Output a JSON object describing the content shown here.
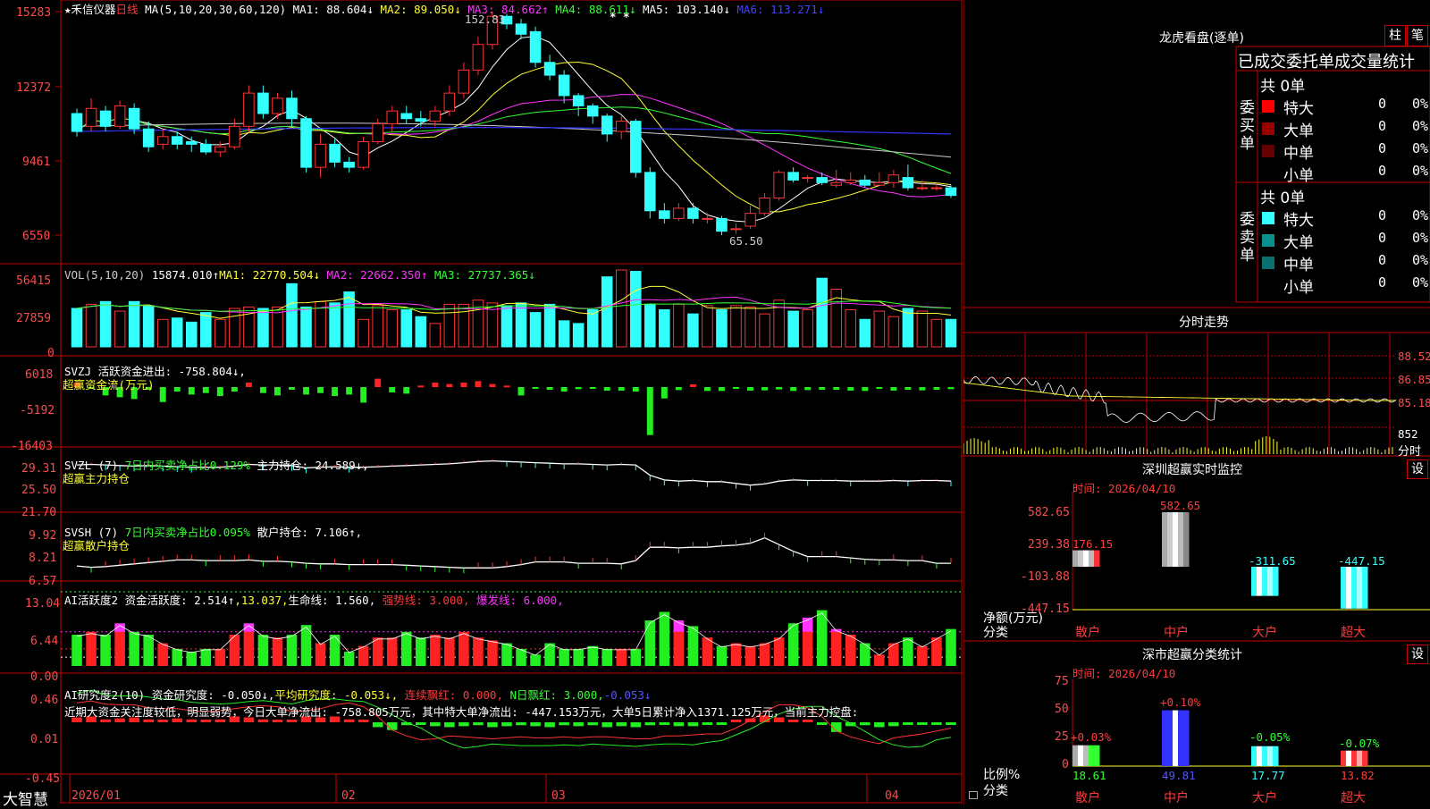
{
  "stock": {
    "name": "★禾信仪器",
    "period": "日线"
  },
  "ma_header": {
    "label": "MA(5,10,20,30,60,120)",
    "items": [
      {
        "text": "MA1: 88.604↓",
        "color": "#ffffff"
      },
      {
        "text": "MA2: 89.050↓",
        "color": "#ffff33"
      },
      {
        "text": "MA3: 84.662↑",
        "color": "#ff33ff"
      },
      {
        "text": "MA4: 88.611↓",
        "color": "#33ff33"
      },
      {
        "text": "MA5: 103.140↓",
        "color": "#ffffff"
      },
      {
        "text": "MA6: 113.271↓",
        "color": "#4444ff"
      }
    ],
    "stars": "* *"
  },
  "price_axis": [
    "15283",
    "12372",
    "9461",
    "6550"
  ],
  "price_annotations": {
    "high": "152.83",
    "low": "65.50"
  },
  "vol": {
    "header_label": "VOL(5,10,20)",
    "value": "15874.010↑",
    "ma1": "MA1: 22770.504↓",
    "ma2": "MA2: 22662.350↑",
    "ma3": "MA3: 27737.365↓",
    "axis": [
      "56415",
      "27859",
      "0"
    ]
  },
  "svzj": {
    "header": "SVZJ  活跃资金进出: -758.804↓,",
    "sub": "超赢资金流(万元)",
    "axis": [
      "6018",
      "-5192",
      "-16403"
    ]
  },
  "svzl": {
    "header_a": "SVZL (7) ",
    "header_b": "7日内买卖净占比0.129%",
    "header_c": " 主力持仓: 24.589↓,",
    "sub": "超赢主力持仓",
    "axis": [
      "29.31",
      "25.50",
      "21.70"
    ]
  },
  "svsh": {
    "header_a": "SVSH (7) ",
    "header_b": "7日内买卖净占比0.095%",
    "header_c": " 散户持仓: 7.106↑,",
    "sub": "超赢散户持仓",
    "axis": [
      "9.92",
      "8.21",
      "6.57"
    ]
  },
  "ai_act": {
    "h1": "AI活跃度2 资金活跃度: 2.514↑",
    "h2": ",13.037,",
    "h3": "生命线: 1.560,",
    "h4": "强势线: 3.000,",
    "h5": "爆发线: 6.000,",
    "axis": [
      "13.04",
      "6.44",
      "0.00"
    ]
  },
  "ai_res": {
    "h1": "AI研究度2(10) 资金研究度: -0.050↓,",
    "h2": "平均研究度: -0.053↓,",
    "h3": "连续飘红: 0.000,",
    "h4": "N日飘红: 3.000,",
    "h5": "-0.053↓",
    "comment": "近期大资金关注度较低，明显弱势，今日大单净流出: -758.805万元，其中特大单净流出: -447.153万元，大单5日累计净入1371.125万元，当前主力控盘:",
    "axis": [
      "0.46",
      "0.01",
      "-0.45"
    ]
  },
  "x_axis": {
    "brand": "大智慧",
    "labels": [
      "2026/01",
      "02",
      "03",
      "04"
    ]
  },
  "right": {
    "dragon_title": "龙虎看盘(逐单)",
    "btn_zhu": "柱",
    "btn_bi": "笔",
    "stat_title": "已成交委托单成交量统计",
    "buy_label": "委买单",
    "sell_label": "委卖单",
    "buy_total": "共 0单",
    "sell_total": "共 0单",
    "buy_rows": [
      {
        "name": "特大",
        "color": "#ff0000",
        "n": "0",
        "p": "0%"
      },
      {
        "name": "大单",
        "color": "#990000",
        "n": "0",
        "p": "0%"
      },
      {
        "name": "中单",
        "color": "#660000",
        "n": "0",
        "p": "0%"
      },
      {
        "name": "小单",
        "color": "#000000",
        "n": "0",
        "p": "0%"
      }
    ],
    "sell_rows": [
      {
        "name": "特大",
        "color": "#33ffff",
        "n": "0",
        "p": "0%"
      },
      {
        "name": "大单",
        "color": "#0a8f8f",
        "n": "0",
        "p": "0%"
      },
      {
        "name": "中单",
        "color": "#0a7070",
        "n": "0",
        "p": "0%"
      },
      {
        "name": "小单",
        "color": "#000000",
        "n": "0",
        "p": "0%"
      }
    ],
    "intraday_title": "分时走势",
    "intraday_axis": [
      "88.52",
      "86.85",
      "85.18",
      "852"
    ],
    "intraday_unit": "分时",
    "monitor_title": "深圳超赢实时监控",
    "monitor_date": "时间: 2026/04/10",
    "monitor_axis": [
      "582.65",
      "239.38",
      "-103.88",
      "-447.15"
    ],
    "monitor_ylabel": "净额(万元)",
    "monitor_xlabel": "分类",
    "cats": [
      "散户",
      "中户",
      "大户",
      "超大"
    ],
    "monitor_values": [
      "176.15",
      "582.65",
      "-311.65",
      "-447.15"
    ],
    "class_title": "深市超赢分类统计",
    "class_date": "时间: 2026/04/10",
    "class_axis": [
      "75",
      "50",
      "25",
      "0"
    ],
    "class_ylabel": "比例%",
    "class_xlabel": "分类",
    "class_pct": [
      "+0.03%",
      "+0.10%",
      "-0.05%",
      "-0.07%"
    ],
    "class_vals": [
      "18.61",
      "49.81",
      "17.77",
      "13.82"
    ],
    "set_btn": "设"
  },
  "chart_data": {
    "type": "candlestick",
    "candles": [
      [
        113,
        106,
        115,
        104
      ],
      [
        108,
        115,
        119,
        106
      ],
      [
        114,
        108,
        116,
        106
      ],
      [
        108,
        116,
        118,
        107
      ],
      [
        115,
        107,
        117,
        105
      ],
      [
        107,
        100,
        110,
        98
      ],
      [
        101,
        104,
        107,
        99
      ],
      [
        104,
        101,
        106,
        99
      ],
      [
        102,
        101,
        104,
        98
      ],
      [
        101,
        98,
        103,
        97
      ],
      [
        98,
        100,
        102,
        96
      ],
      [
        100,
        108,
        111,
        99
      ],
      [
        108,
        121,
        124,
        106
      ],
      [
        121,
        113,
        124,
        111
      ],
      [
        113,
        119,
        121,
        111
      ],
      [
        119,
        111,
        122,
        108
      ],
      [
        111,
        92,
        112,
        90
      ],
      [
        92,
        101,
        105,
        88
      ],
      [
        101,
        94,
        103,
        92
      ],
      [
        94,
        92,
        96,
        90
      ],
      [
        92,
        102,
        104,
        91
      ],
      [
        102,
        109,
        111,
        101
      ],
      [
        109,
        114,
        116,
        106
      ],
      [
        113,
        111,
        116,
        109
      ],
      [
        111,
        110,
        114,
        108
      ],
      [
        110,
        114,
        116,
        108
      ],
      [
        114,
        121,
        124,
        112
      ],
      [
        121,
        130,
        133,
        119
      ],
      [
        130,
        140,
        143,
        128
      ],
      [
        140,
        151,
        152.83,
        138
      ],
      [
        151,
        148,
        152,
        146
      ],
      [
        148,
        144,
        150,
        142
      ],
      [
        145,
        133,
        147,
        131
      ],
      [
        133,
        128,
        136,
        126
      ],
      [
        128,
        120,
        130,
        117
      ],
      [
        120,
        116,
        121,
        112
      ],
      [
        116,
        112,
        117,
        109
      ],
      [
        112,
        105,
        113,
        102
      ],
      [
        106,
        110,
        112,
        103
      ],
      [
        110,
        90,
        111,
        88
      ],
      [
        90,
        75,
        92,
        72
      ],
      [
        75,
        72,
        78,
        70
      ],
      [
        72,
        76,
        78,
        71
      ],
      [
        76,
        72,
        78,
        70
      ],
      [
        72,
        72,
        74,
        70
      ],
      [
        72,
        67,
        73,
        65.5
      ],
      [
        68,
        68,
        70,
        66
      ],
      [
        69,
        74,
        77,
        68
      ],
      [
        74,
        80,
        82,
        73
      ],
      [
        80,
        90,
        91,
        79
      ],
      [
        90,
        87,
        92,
        86
      ],
      [
        88,
        88,
        89,
        86
      ],
      [
        88,
        86,
        90,
        85
      ],
      [
        85,
        86,
        91,
        84
      ],
      [
        86,
        87,
        90,
        85
      ],
      [
        87,
        85,
        89,
        84
      ],
      [
        85,
        86,
        90,
        85
      ],
      [
        86,
        89,
        91,
        84
      ],
      [
        88,
        84,
        93,
        83
      ],
      [
        84,
        84,
        87,
        83
      ],
      [
        84,
        84,
        86,
        83
      ],
      [
        84,
        81,
        85,
        80
      ]
    ],
    "volume": [
      28,
      31,
      33,
      26,
      33,
      30,
      20,
      21,
      18,
      25,
      20,
      28,
      29,
      28,
      29,
      46,
      29,
      33,
      32,
      40,
      20,
      30,
      27,
      27,
      22,
      17,
      31,
      31,
      34,
      32,
      30,
      32,
      25,
      31,
      19,
      17,
      27,
      51,
      56,
      55,
      31,
      27,
      31,
      24,
      30,
      27,
      30,
      29,
      24,
      34,
      26,
      27,
      50,
      42,
      27,
      20,
      26,
      22,
      28,
      26,
      20,
      20
    ],
    "svzj": [
      1500,
      -200,
      -2800,
      -3400,
      -4000,
      -900,
      -5000,
      -1500,
      -2500,
      -2000,
      -3000,
      -1500,
      1500,
      -2000,
      -2800,
      -900,
      -2500,
      -2000,
      -3000,
      -2500,
      -5200,
      2800,
      -1800,
      -2200,
      500,
      1500,
      1000,
      1500,
      2000,
      1000,
      500,
      -2800,
      -400,
      -900,
      -1500,
      -700,
      -500,
      -1200,
      -1200,
      -1500,
      -16000,
      -3800,
      -1000,
      900,
      -1300,
      -1300,
      -500,
      -1200,
      -1100,
      -800,
      -1300,
      -1000,
      -900,
      -900,
      -1200,
      -1300,
      -400,
      -1200,
      -900,
      -1100,
      -900,
      -700
    ],
    "svzl": [
      28.2,
      28.3,
      28.2,
      28.1,
      28.0,
      28.1,
      28.0,
      27.9,
      27.8,
      27.8,
      27.8,
      28.0,
      28.3,
      28.2,
      28.2,
      28.1,
      27.7,
      27.8,
      27.9,
      27.8,
      27.8,
      27.9,
      28.0,
      28.1,
      28.2,
      28.3,
      28.4,
      28.6,
      28.8,
      28.9,
      28.8,
      28.7,
      28.6,
      28.5,
      28.4,
      28.4,
      28.3,
      28.2,
      28.3,
      28.2,
      26.4,
      25.6,
      25.4,
      25.5,
      25.3,
      25.3,
      25.0,
      24.7,
      24.9,
      25.4,
      25.6,
      25.5,
      25.5,
      25.5,
      25.4,
      25.4,
      25.4,
      25.5,
      25.4,
      25.5,
      25.5,
      25.4
    ],
    "svsh": [
      6.9,
      6.8,
      6.85,
      6.95,
      7.05,
      7.15,
      7.25,
      7.35,
      7.35,
      7.3,
      7.3,
      7.3,
      7.35,
      7.25,
      7.25,
      7.2,
      7.1,
      7.05,
      7.05,
      7.0,
      7.0,
      7.0,
      7.0,
      6.95,
      6.9,
      6.85,
      6.8,
      6.75,
      6.75,
      6.75,
      6.85,
      7.0,
      7.2,
      7.2,
      7.2,
      7.1,
      7.1,
      7.1,
      7.05,
      7.3,
      8.3,
      8.3,
      8.25,
      8.3,
      8.3,
      8.4,
      8.45,
      8.6,
      9.0,
      8.5,
      8.0,
      7.6,
      7.6,
      7.6,
      7.5,
      7.4,
      7.35,
      7.35,
      7.3,
      7.3,
      7.1,
      7.1
    ],
    "ai_act": [
      5.5,
      6.0,
      5.5,
      7.5,
      6.0,
      5.5,
      4.0,
      3.0,
      2.5,
      3.0,
      3.0,
      5.5,
      7.5,
      5.5,
      5.0,
      5.5,
      7.2,
      4.0,
      5.5,
      2.5,
      3.5,
      5.0,
      5.0,
      6.0,
      5.0,
      5.5,
      5.0,
      6.0,
      5.0,
      4.5,
      4.0,
      3.0,
      2.0,
      4.0,
      3.0,
      3.0,
      3.5,
      3.0,
      3.0,
      3.0,
      8.0,
      9.5,
      8.0,
      7.0,
      5.0,
      3.5,
      4.0,
      3.5,
      4.0,
      5.0,
      7.5,
      8.5,
      9.8,
      6.5,
      5.5,
      4.0,
      2.0,
      4.0,
      5.0,
      3.5,
      5.0,
      6.5
    ],
    "ai_res": [
      0.05,
      0.06,
      0.03,
      0.04,
      0.05,
      0.03,
      0.02,
      0.04,
      0.03,
      0.02,
      0.03,
      0.06,
      0.05,
      0.03,
      0.02,
      0.01,
      0.06,
      0.05,
      0.06,
      0.03,
      0.02,
      -0.05,
      -0.08,
      -0.03,
      -0.02,
      -0.04,
      -0.05,
      -0.04,
      -0.03,
      -0.05,
      -0.04,
      -0.03,
      -0.04,
      -0.05,
      -0.03,
      -0.04,
      -0.03,
      -0.05,
      -0.04,
      -0.05,
      -0.03,
      -0.02,
      -0.04,
      -0.04,
      -0.02,
      -0.02,
      0.02,
      0.04,
      0.07,
      0.05,
      0.02,
      0.01,
      -0.02,
      -0.1,
      -0.04,
      -0.03,
      -0.05,
      -0.04,
      -0.02,
      -0.01,
      -0.02,
      -0.01
    ]
  }
}
